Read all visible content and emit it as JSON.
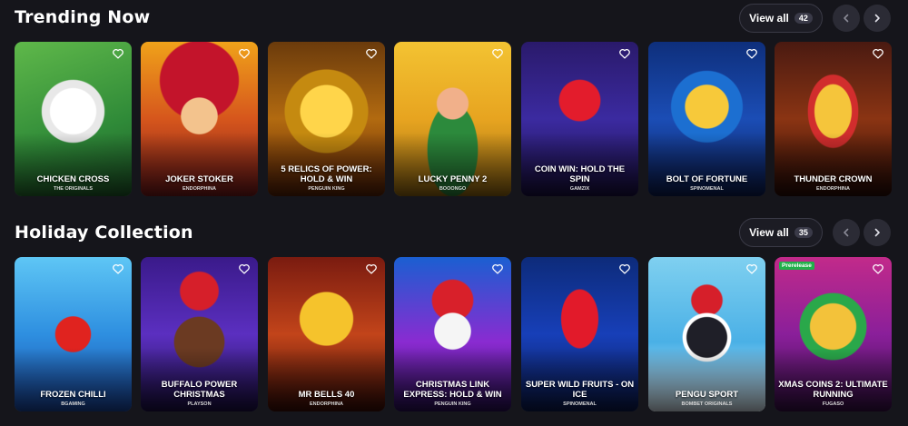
{
  "sections": [
    {
      "title": "Trending Now",
      "view_all_label": "View all",
      "view_all_count": "42",
      "cards": [
        {
          "name": "CHICKEN CROSS",
          "provider": "THE ORIGINALS",
          "badge": ""
        },
        {
          "name": "JOKER STOKER",
          "provider": "ENDORPHINA",
          "badge": ""
        },
        {
          "name": "5 RELICS OF POWER: HOLD & WIN",
          "provider": "PENGUIN KING",
          "badge": ""
        },
        {
          "name": "LUCKY PENNY 2",
          "provider": "BOOONGO",
          "badge": ""
        },
        {
          "name": "COIN WIN: HOLD THE SPIN",
          "provider": "GAMZIX",
          "badge": ""
        },
        {
          "name": "BOLT OF FORTUNE",
          "provider": "SPINOMENAL",
          "badge": ""
        },
        {
          "name": "THUNDER CROWN",
          "provider": "ENDORPHINA",
          "badge": ""
        }
      ]
    },
    {
      "title": "Holiday Collection",
      "view_all_label": "View all",
      "view_all_count": "35",
      "cards": [
        {
          "name": "FROZEN CHILLI",
          "provider": "BGAMING",
          "badge": ""
        },
        {
          "name": "BUFFALO POWER CHRISTMAS",
          "provider": "PLAYSON",
          "badge": ""
        },
        {
          "name": "MR BELLS 40",
          "provider": "ENDORPHINA",
          "badge": ""
        },
        {
          "name": "CHRISTMAS LINK EXPRESS: HOLD & WIN",
          "provider": "PENGUIN KING",
          "badge": ""
        },
        {
          "name": "SUPER WILD FRUITS - ON ICE",
          "provider": "SPINOMENAL",
          "badge": ""
        },
        {
          "name": "PENGU SPORT",
          "provider": "BOMBET ORIGINALS",
          "badge": ""
        },
        {
          "name": "XMAS COINS 2: ULTIMATE RUNNING",
          "provider": "FUGASO",
          "badge": "Prerelease"
        }
      ]
    }
  ],
  "icons": {
    "favorite": "heart-outline-icon",
    "prev": "chevron-left-icon",
    "next": "chevron-right-icon"
  },
  "colors": {
    "background": "#15151b",
    "button_bg": "#1c1c24",
    "nav_bg": "#2b2b35",
    "badge_green": "#21b04a"
  }
}
